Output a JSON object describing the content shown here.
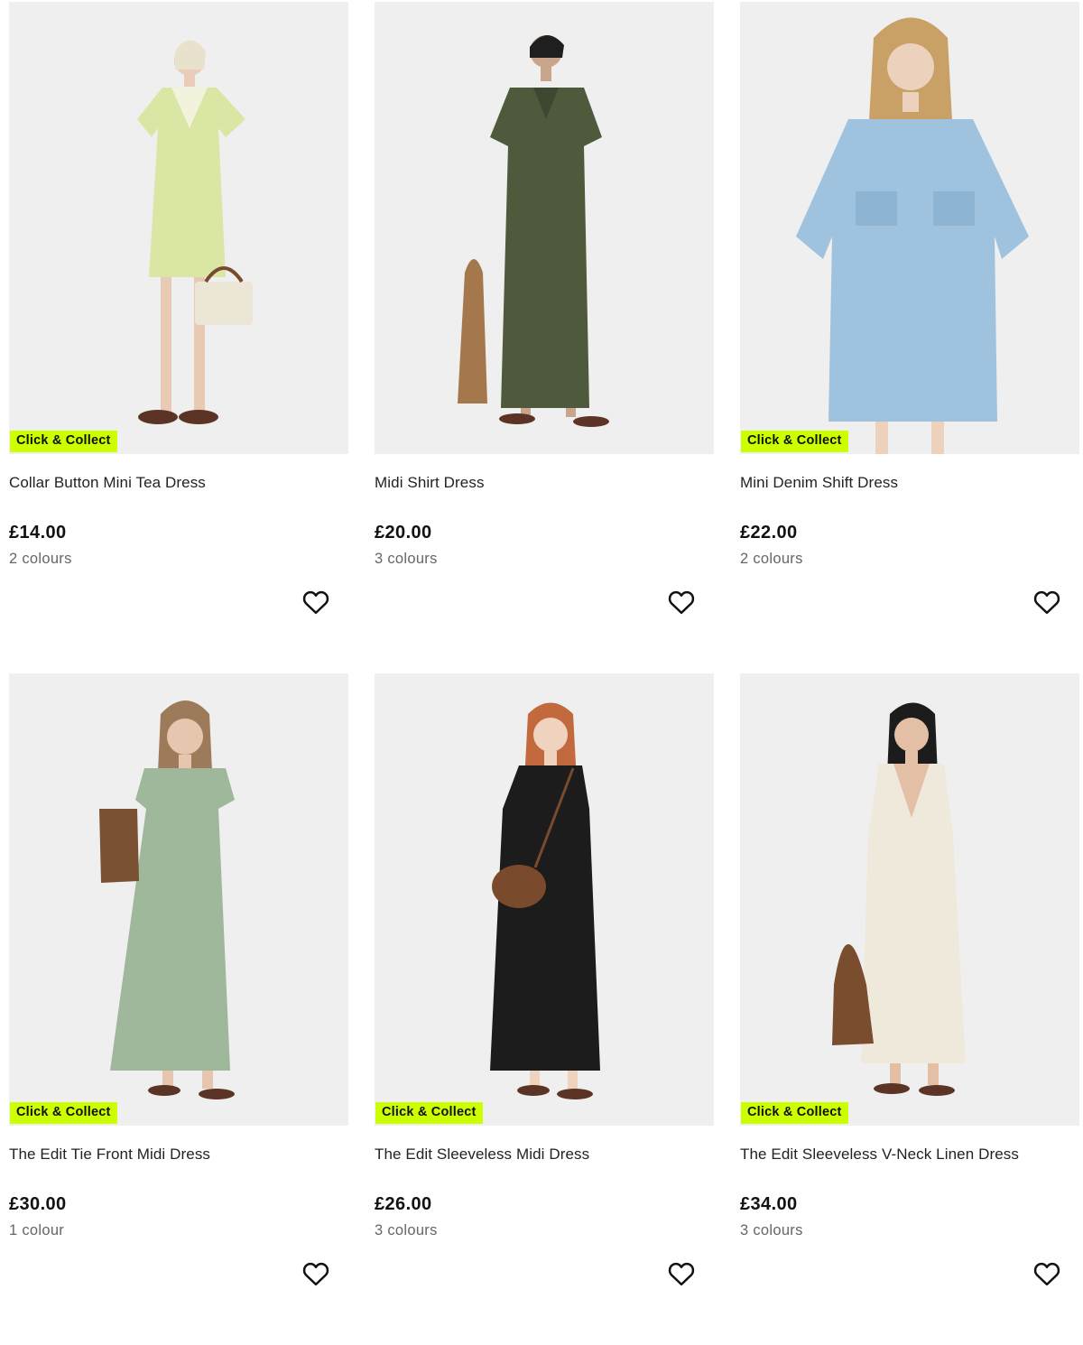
{
  "products": [
    {
      "badge": "Click & Collect",
      "title": "Collar Button Mini Tea Dress",
      "price": "£14.00",
      "colours": "2 colours",
      "image_icon": "dress-photo",
      "dress_color": "#d9e6a4",
      "bag_color": "#ece6d6"
    },
    {
      "badge": "",
      "title": "Midi Shirt Dress",
      "price": "£20.00",
      "colours": "3 colours",
      "image_icon": "dress-photo",
      "dress_color": "#4f5a3c",
      "bag_color": "#a5774c"
    },
    {
      "badge": "Click & Collect",
      "title": "Mini Denim Shift Dress",
      "price": "£22.00",
      "colours": "2 colours",
      "image_icon": "dress-photo",
      "dress_color": "#9fc2df",
      "bag_color": ""
    },
    {
      "badge": "Click & Collect",
      "title": "The Edit Tie Front Midi Dress",
      "price": "£30.00",
      "colours": "1 colour",
      "image_icon": "dress-photo",
      "dress_color": "#9fb79b",
      "bag_color": "#7a5032"
    },
    {
      "badge": "Click & Collect",
      "title": "The Edit Sleeveless Midi Dress",
      "price": "£26.00",
      "colours": "3 colours",
      "image_icon": "dress-photo",
      "dress_color": "#1c1c1c",
      "bag_color": "#7a4a2c"
    },
    {
      "badge": "Click & Collect",
      "title": "The Edit Sleeveless V-Neck Linen Dress",
      "price": "£34.00",
      "colours": "3 colours",
      "image_icon": "dress-photo",
      "dress_color": "#efe9dc",
      "bag_color": "#7a4d2e"
    }
  ],
  "theme": {
    "badge_color": "#ccff00",
    "image_bg": "#efefef"
  }
}
